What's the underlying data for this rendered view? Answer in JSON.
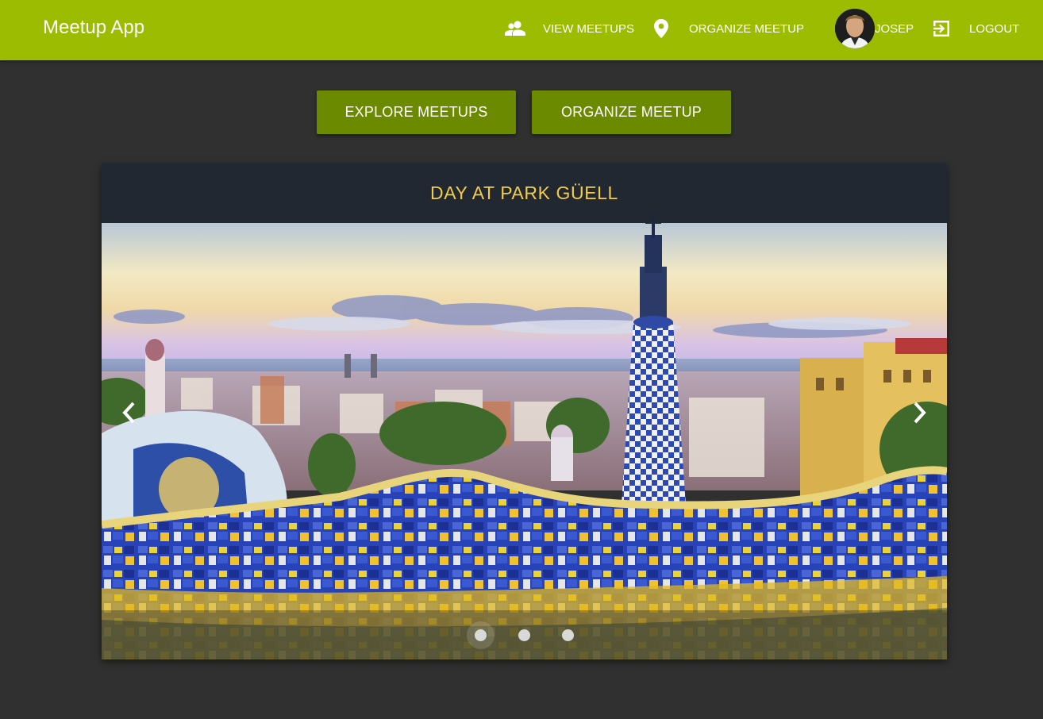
{
  "toolbar": {
    "title": "Meetup App",
    "nav": {
      "view_meetups": "VIEW MEETUPS",
      "organize_meetup": "ORGANIZE MEETUP",
      "user": "JOSEP",
      "logout": "LOGOUT"
    },
    "icons": [
      "supervisor-account-icon",
      "location-pin-icon",
      "avatar",
      "logout-icon"
    ]
  },
  "actions": {
    "explore": "EXPLORE MEETUPS",
    "organize": "ORGANIZE MEETUP"
  },
  "carousel": {
    "slide_title": "DAY AT PARK GÜELL",
    "slide_count": 3,
    "active_slide": 1
  },
  "colors": {
    "toolbar": "#9bbc00",
    "button": "#6b8a00",
    "background": "#303030",
    "title_text": "#f3cc4a"
  }
}
